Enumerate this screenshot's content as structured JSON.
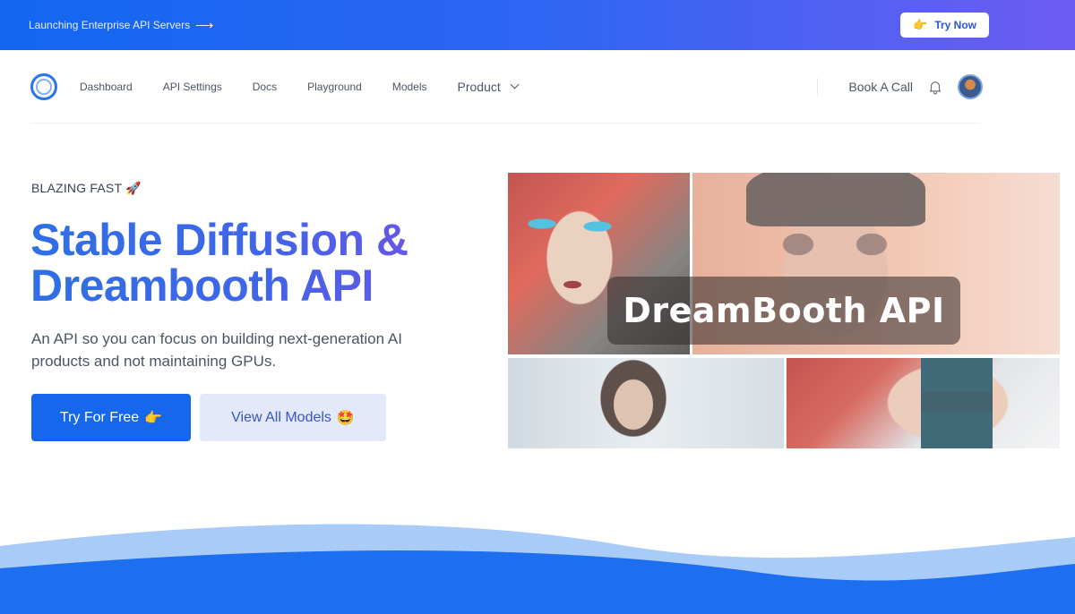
{
  "banner": {
    "text": "Launching Enterprise API Servers",
    "arrow": "⟶",
    "try_now_icon": "👉",
    "try_now_label": "Try Now"
  },
  "nav": {
    "items": [
      {
        "label": "Dashboard"
      },
      {
        "label": "API Settings"
      },
      {
        "label": "Docs"
      },
      {
        "label": "Playground"
      },
      {
        "label": "Models"
      }
    ],
    "product_label": "Product",
    "book_call_label": "Book A Call"
  },
  "hero": {
    "eyebrow": "BLAZING FAST 🚀",
    "headline_line1": "Stable Diffusion &",
    "headline_line2": "Dreambooth API",
    "subtitle": "An API so you can focus on building next-generation AI products and not maintaining GPUs.",
    "primary_button": "Try For Free",
    "primary_button_icon": "👉",
    "secondary_button": "View All Models",
    "secondary_button_icon": "🤩"
  },
  "collage": {
    "overlay_text": "DreamBooth API"
  },
  "colors": {
    "brand_blue": "#1667ec",
    "banner_gradient_end": "#6e5cf3",
    "headline_purple": "#7a4fe4",
    "secondary_bg": "#e3e9fb"
  }
}
